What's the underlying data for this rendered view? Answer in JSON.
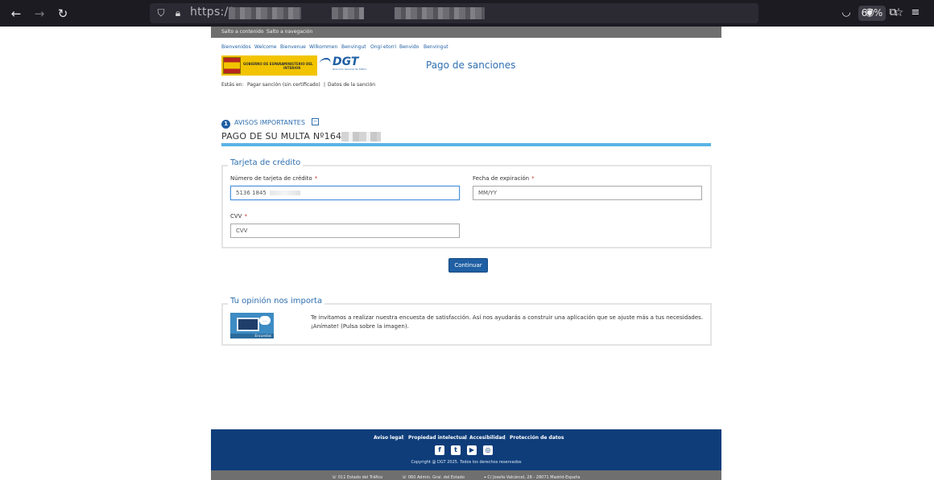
{
  "browser": {
    "url_prefix": "https://",
    "zoom": "67%"
  },
  "skip_links": [
    "Salto a contenido",
    "Salto a navegación"
  ],
  "languages": [
    "Bienvenidos",
    "Welcome",
    "Bienvenue",
    "Wilkommen",
    "Benvingut",
    "Ongi etorri",
    "Benvido",
    "Benvingut"
  ],
  "logos": {
    "gobierno": "GOBIERNO DE ESPAÑA",
    "ministerio": "MINISTERIO DEL INTERIOR",
    "dgt": "DGT",
    "dgt_sub": "Dirección General de Tráfico"
  },
  "page_title": "Pago de sanciones",
  "breadcrumb": {
    "label": "Estás en:",
    "items": [
      "Pagar sanción (sin certificado)",
      "Datos de la sanción"
    ],
    "separator": "|"
  },
  "avisos": {
    "number": "1",
    "title": "AVISOS IMPORTANTES",
    "toggle": "⊟"
  },
  "multa_title": "PAGO DE SU MULTA Nº16435",
  "credit_card": {
    "legend": "Tarjeta de crédito",
    "card_number_label": "Número de tarjeta de crédito",
    "card_number_value": "5136 1845",
    "expiry_label": "Fecha de expiración",
    "expiry_placeholder": "MM/YY",
    "cvv_label": "CVV",
    "cvv_placeholder": "CVV",
    "required_mark": "*"
  },
  "continue_button": "Continuar",
  "opinion": {
    "legend": "Tu opinión nos importa",
    "image_label": "Encuestas",
    "line1": "Te invitamos a realizar nuestra encuesta de satisfacción. Así nos ayudarás a construir una aplicación que se ajuste más a tus necesidades.",
    "line2": "¡Anímate! (Pulsa sobre la imagen)."
  },
  "footer": {
    "links": [
      "Aviso legal",
      "Propiedad intelectual",
      "Accesibilidad",
      "Protección de datos"
    ],
    "separator": "|",
    "social": [
      "f",
      "t",
      "▶",
      "◎"
    ],
    "copyright": "Copyright @ DGT 2025. Todos los derechos reservados"
  },
  "bottom_bar": [
    "011 Estado del Tráfico",
    "060 Admin. Gral. del Estado",
    "C/ Josefa Valcárcel, 28 - 28071 Madrid-España"
  ],
  "colors": {
    "accent": "#2f6fb0",
    "footer": "#0e3d7a",
    "rule": "#5ab4e5",
    "brand_yellow": "#f2c400"
  }
}
